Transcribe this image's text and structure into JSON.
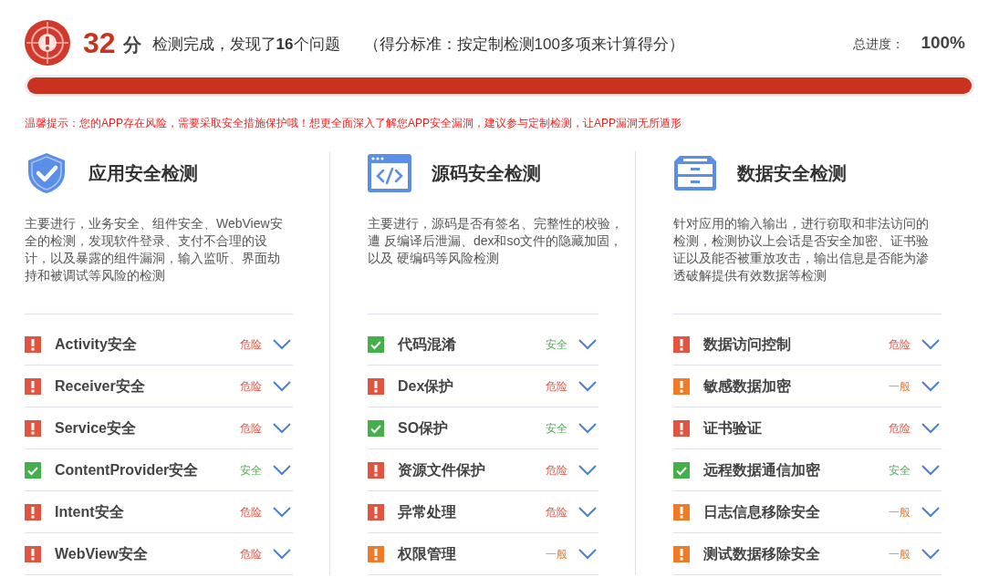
{
  "header": {
    "score": "32",
    "score_unit": "分",
    "summary": "检测完成，发现了**16**个问题",
    "standard": "（得分标准：按定制检测100多项来计算得分）",
    "progress_label": "总进度：",
    "progress_value": "100%",
    "level": 1
  },
  "tip": "温馨提示：您的APP存在风险，需要采取安全措施保护哦！想更全面深入了解您APP安全漏洞，建议参与定制检测，让APP漏洞无所遁形",
  "sections": [
    {
      "kind": "shield",
      "title": "应用安全检测",
      "description": "主要进行，业务安全、组件安全、WebView安全的检测，发现软件登录、支付不合理的设计，以及暴露的组件漏洞，输入监听、界面劫持和被调试等风险的检测",
      "items": [
        {
          "label": "Activity安全",
          "kind": "danger",
          "status": "危险"
        },
        {
          "label": "Receiver安全",
          "kind": "danger",
          "status": "危险"
        },
        {
          "label": "Service安全",
          "kind": "danger",
          "status": "危险"
        },
        {
          "label": "ContentProvider安全",
          "kind": "safe",
          "status": "安全"
        },
        {
          "label": "Intent安全",
          "kind": "danger",
          "status": "危险"
        },
        {
          "label": "WebView安全",
          "kind": "danger",
          "status": "危险"
        }
      ]
    },
    {
      "kind": "code",
      "title": "源码安全检测",
      "description": "主要进行，源码是否有签名、完整性的校验，遭 反编译后泄漏、dex和so文件的隐藏加固，以及 硬编码等风险检测",
      "items": [
        {
          "label": "代码混淆",
          "kind": "safe",
          "status": "安全"
        },
        {
          "label": "Dex保护",
          "kind": "danger",
          "status": "危险"
        },
        {
          "label": "SO保护",
          "kind": "safe",
          "status": "安全"
        },
        {
          "label": "资源文件保护",
          "kind": "danger",
          "status": "危险"
        },
        {
          "label": "异常处理",
          "kind": "danger",
          "status": "危险"
        },
        {
          "label": "权限管理",
          "kind": "warning",
          "status": "一般"
        }
      ]
    },
    {
      "kind": "data",
      "title": "数据安全检测",
      "description": "针对应用的输入输出，进行窃取和非法访问的检测，检测协议上会话是否安全加密、证书验证以及能否被重放攻击，输出信息是否能为渗透破解提供有效数据等检测",
      "items": [
        {
          "label": "数据访问控制",
          "kind": "danger",
          "status": "危险"
        },
        {
          "label": "敏感数据加密",
          "kind": "warning",
          "status": "一般"
        },
        {
          "label": "证书验证",
          "kind": "danger",
          "status": "危险"
        },
        {
          "label": "远程数据通信加密",
          "kind": "safe",
          "status": "安全"
        },
        {
          "label": "日志信息移除安全",
          "kind": "warning",
          "status": "一般"
        },
        {
          "label": "测试数据移除安全",
          "kind": "warning",
          "status": "一般"
        }
      ]
    }
  ]
}
